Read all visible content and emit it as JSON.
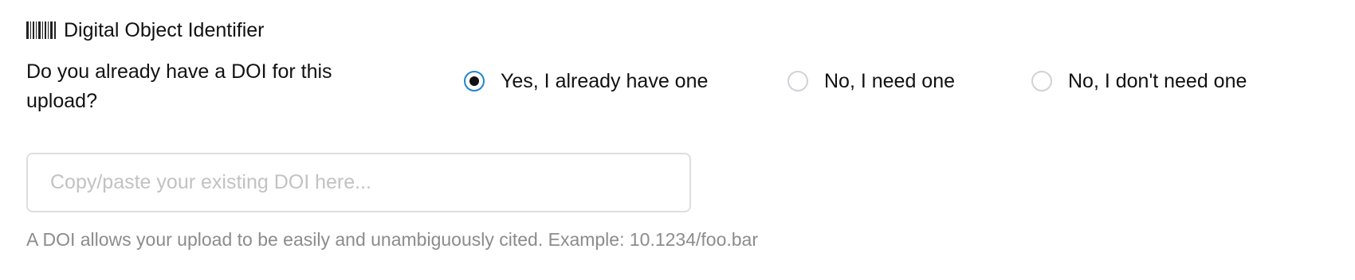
{
  "section": {
    "icon": "barcode-icon",
    "title": "Digital Object Identifier"
  },
  "question": {
    "text": "Do you already have a DOI for this upload?"
  },
  "options": [
    {
      "label": "Yes, I already have one",
      "checked": true
    },
    {
      "label": "No, I need one",
      "checked": false
    },
    {
      "label": "No, I don't need one",
      "checked": false
    }
  ],
  "doi_field": {
    "value": "",
    "placeholder": "Copy/paste your existing DOI here..."
  },
  "help": {
    "text": "A DOI allows your upload to be easily and unambiguously cited. Example: 10.1234/foo.bar"
  },
  "colors": {
    "accent": "#2185d0",
    "placeholder": "#c2c2c2",
    "help_text": "#8c8c8c",
    "input_border": "#dedede"
  }
}
